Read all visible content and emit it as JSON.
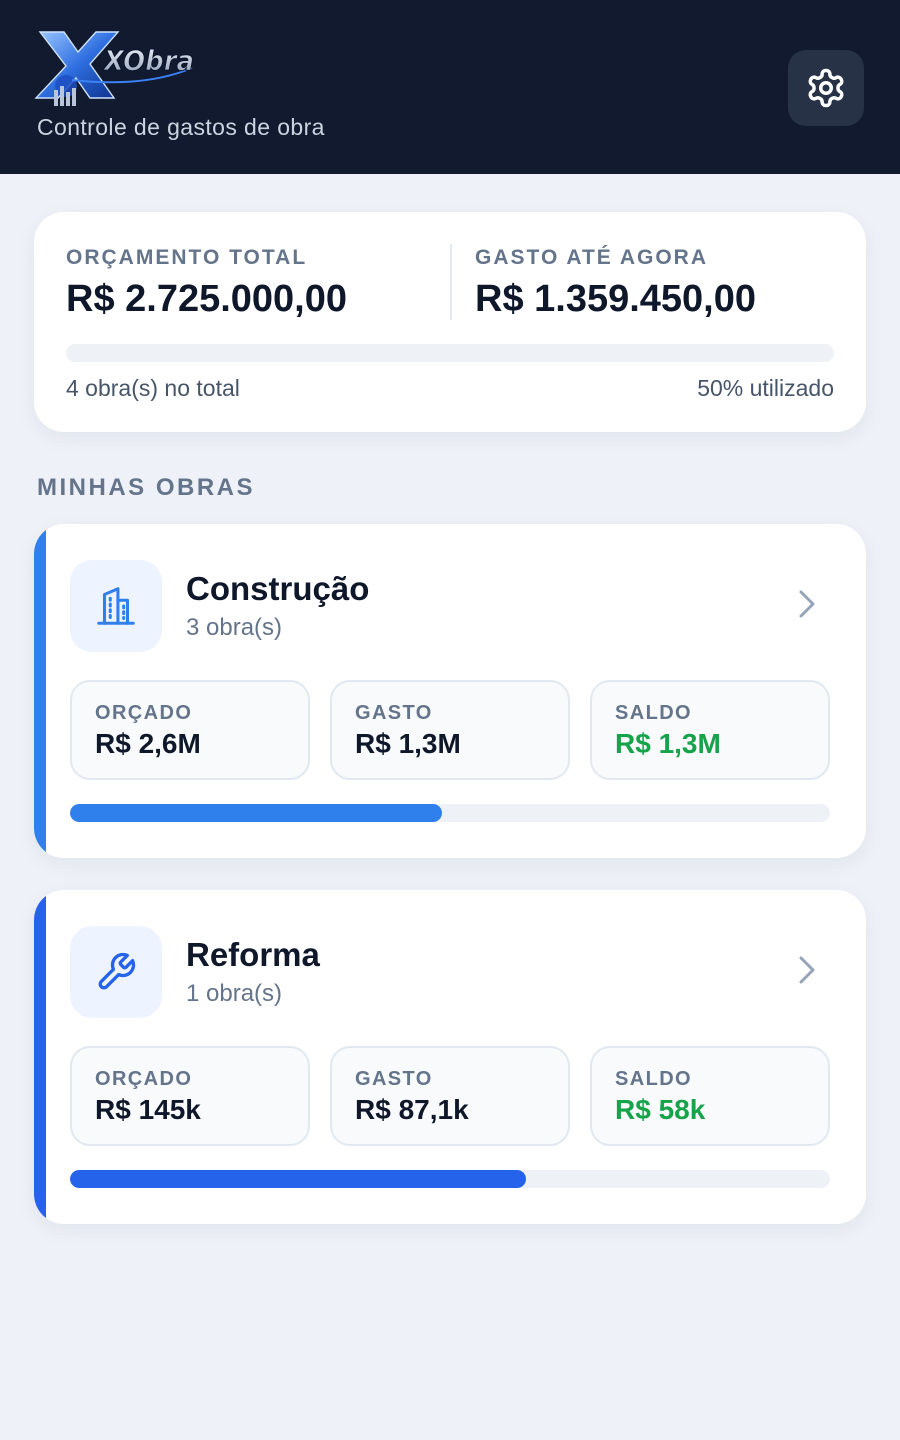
{
  "header": {
    "logo_text": "XObra",
    "subtitle": "Controle de gastos de obra",
    "settings_icon": "gear-icon"
  },
  "summary": {
    "budget_label": "ORÇAMENTO TOTAL",
    "budget_value": "R$ 2.725.000,00",
    "spent_label": "GASTO ATÉ AGORA",
    "spent_value": "R$ 1.359.450,00",
    "works_count": "4 obra(s) no total",
    "used_text": "50% utilizado",
    "progress_fraction": 0.0
  },
  "section_title": "MINHAS OBRAS",
  "categories": [
    {
      "title": "Construção",
      "count": "3 obra(s)",
      "icon": "building-icon",
      "accent_color": "#2f80ed",
      "bar_color": "#2f80ed",
      "progress_fraction": 0.49,
      "stats": [
        {
          "label": "ORÇADO",
          "value": "R$ 2,6M"
        },
        {
          "label": "GASTO",
          "value": "R$ 1,3M"
        },
        {
          "label": "SALDO",
          "value": "R$ 1,3M"
        }
      ]
    },
    {
      "title": "Reforma",
      "count": "1 obra(s)",
      "icon": "wrench-icon",
      "accent_color": "#2563eb",
      "bar_color": "#2563eb",
      "progress_fraction": 0.6,
      "stats": [
        {
          "label": "ORÇADO",
          "value": "R$ 145k"
        },
        {
          "label": "GASTO",
          "value": "R$ 87,1k"
        },
        {
          "label": "SALDO",
          "value": "R$ 58k"
        }
      ]
    }
  ],
  "colors": {
    "header_bg": "#111a2e",
    "positive": "#16a34a",
    "page_bg": "#eef2f8"
  }
}
